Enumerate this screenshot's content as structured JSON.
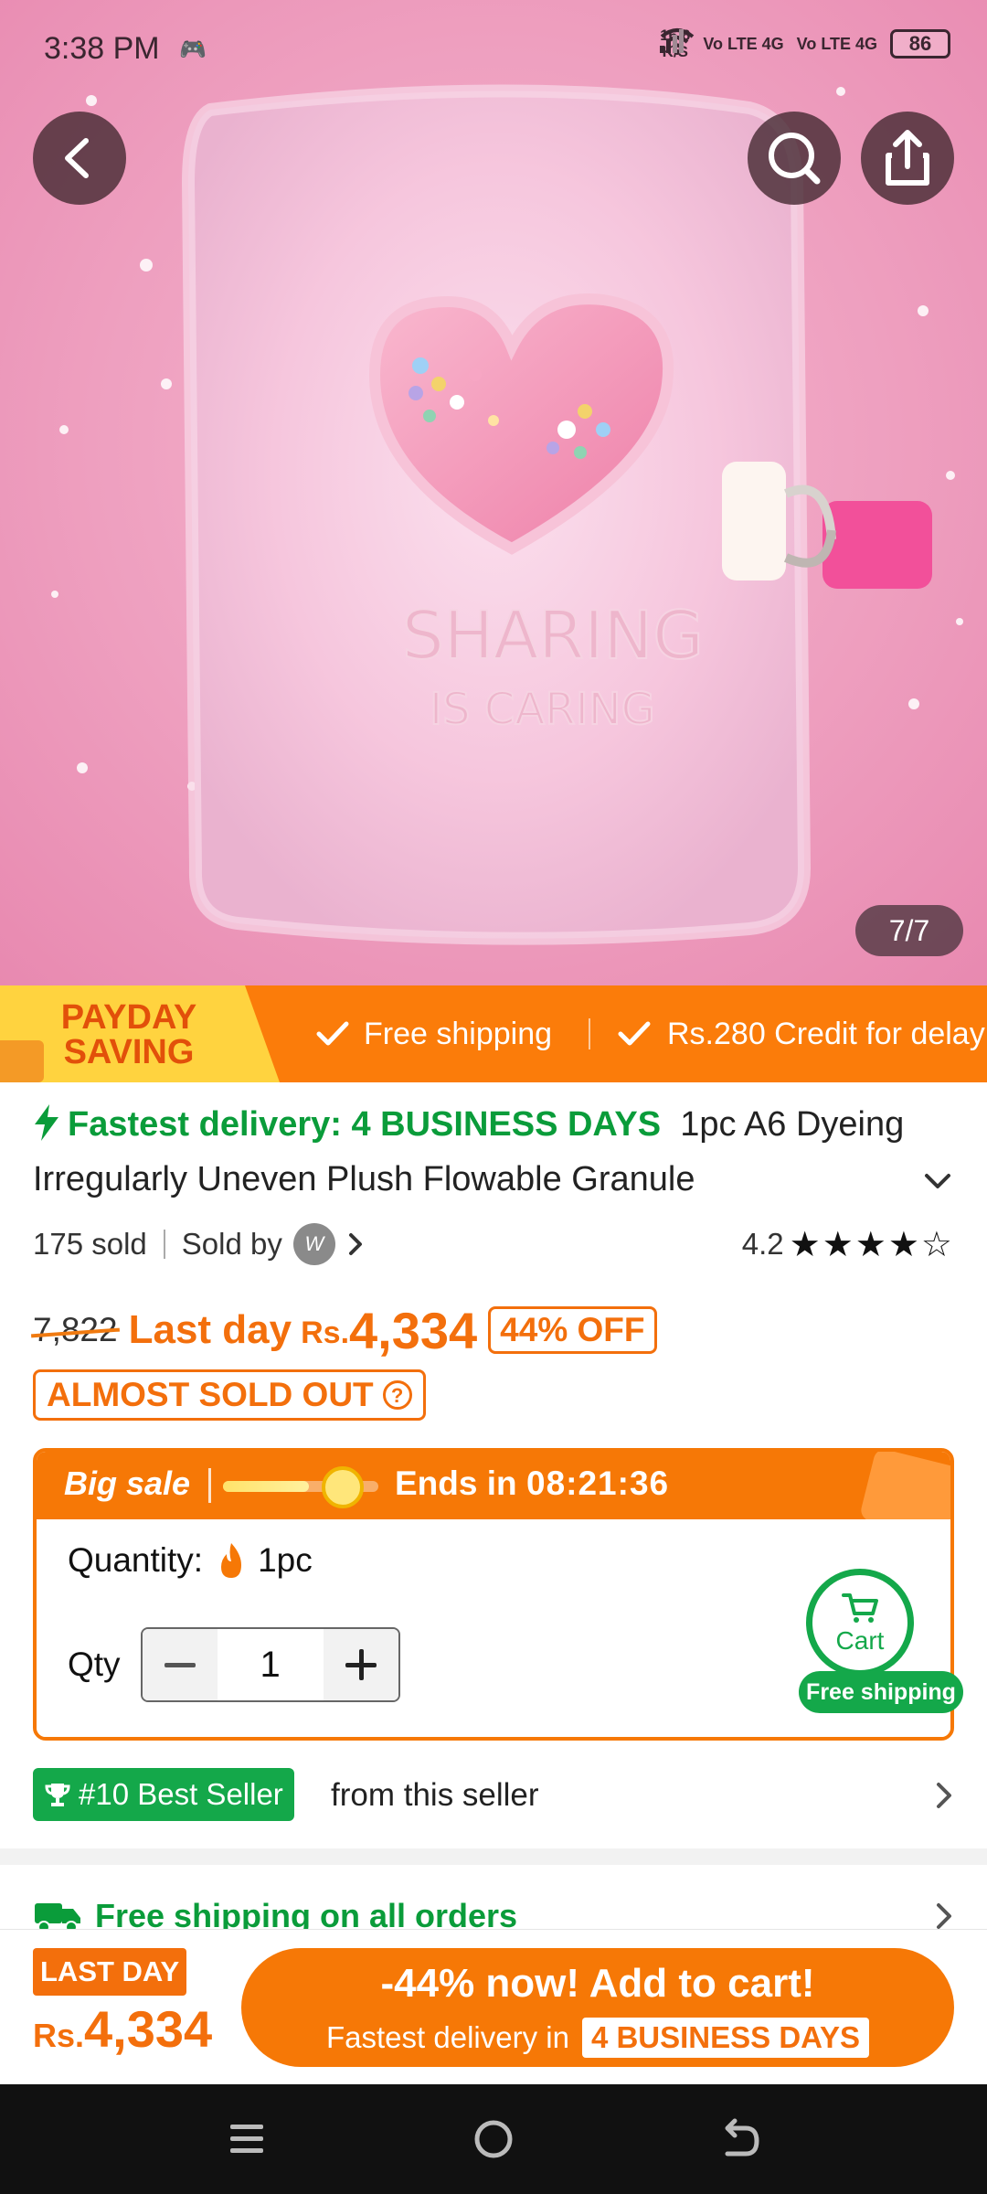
{
  "status_bar": {
    "time": "3:38 PM",
    "speed_value": "16.6",
    "speed_unit": "K/S",
    "network_1": "Vo LTE 4G",
    "network_2": "Vo LTE 4G",
    "battery": "86"
  },
  "gallery": {
    "counter": "7/7",
    "product_print_1": "SHARING",
    "product_print_2": "IS CARING"
  },
  "promo_banner": {
    "payday_line1": "PAYDAY",
    "payday_line2": "SAVING",
    "item_1": "Free shipping",
    "item_2": "Rs.280 Credit for delay"
  },
  "product": {
    "fast_delivery": "Fastest delivery: 4 BUSINESS DAYS",
    "title": "1pc A6 Dyeing Irregularly Uneven Plush Flowable Granule",
    "sold_count": "175 sold",
    "sold_by": "Sold by",
    "seller_avatar": "W",
    "rating": "4.2",
    "stars": "★★★★☆",
    "old_price": "7,822",
    "last_day": "Last day",
    "currency": "Rs.",
    "price": "4,334",
    "discount": "44% OFF",
    "stock_status": "ALMOST SOLD OUT",
    "stock_help": "?"
  },
  "big_sale": {
    "label": "Big sale",
    "progress": 0.55,
    "ends_in": "Ends in",
    "timer": "08:21:36",
    "quantity_label": "Quantity:",
    "quantity_value": "1pc",
    "qty_label": "Qty",
    "qty_value": "1"
  },
  "cart_fab": {
    "label": "Cart",
    "badge": "Free shipping"
  },
  "best_seller": {
    "badge": "#10 Best Seller",
    "text": "from this seller"
  },
  "shipping_row": {
    "text": "Free shipping on all orders"
  },
  "bottom_bar": {
    "badge": "LAST DAY",
    "currency": "Rs.",
    "price": "4,334",
    "cta_line1": "-44% now! Add to cart!",
    "cta_line2": "Fastest delivery in",
    "cta_chip": "4 BUSINESS DAYS"
  },
  "colors": {
    "accent_orange": "#f67806",
    "accent_green": "#14a84a",
    "promo_yellow": "#ffd33f"
  }
}
